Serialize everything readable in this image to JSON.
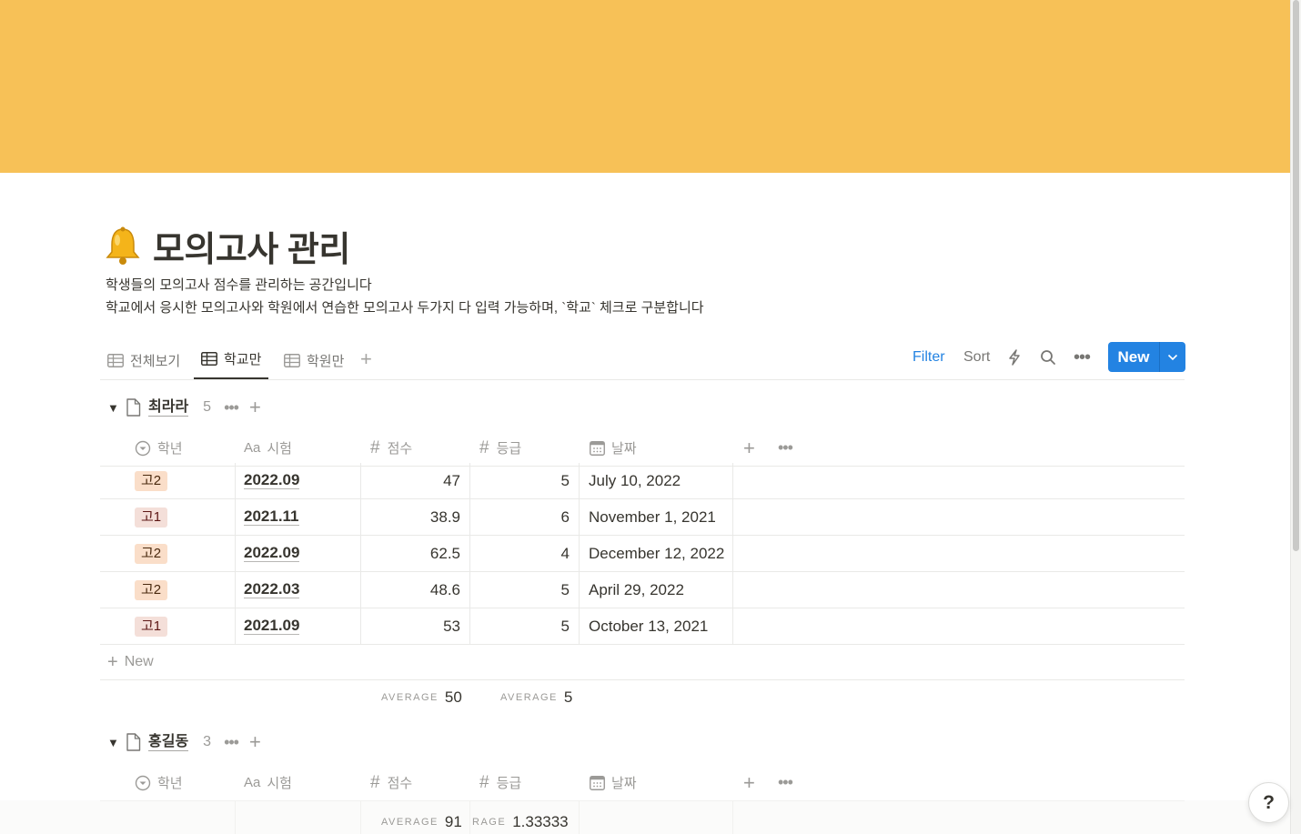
{
  "colors": {
    "cover": "#f7c157",
    "accent": "#2383e2",
    "tag_grade2": "#fadec9",
    "tag_grade1": "#f4dfd9"
  },
  "page": {
    "icon": "bell-emoji",
    "title": "모의고사 관리",
    "description_line1": "학생들의 모의고사 점수를 관리하는 공간입니다",
    "description_line2": "학교에서 응시한 모의고사와 학원에서 연습한 모의고사 두가지 다 입력 가능하며, `학교` 체크로 구분합니다"
  },
  "views": {
    "tabs": [
      {
        "label": "전체보기",
        "icon": "table-icon",
        "active": false
      },
      {
        "label": "학교만",
        "icon": "table-icon",
        "active": true
      },
      {
        "label": "학원만",
        "icon": "table-icon",
        "active": false
      }
    ],
    "add_icon": "plus-icon"
  },
  "toolbar": {
    "filter_label": "Filter",
    "sort_label": "Sort",
    "automation_icon": "lightning-icon",
    "search_icon": "search-icon",
    "more_icon": "ellipsis-icon",
    "new_label": "New"
  },
  "columns": {
    "grade": "학년",
    "exam": "시험",
    "exam_prefix": "Aa",
    "score": "점수",
    "rank": "등급",
    "date": "날짜",
    "number_prefix": "#"
  },
  "groups": [
    {
      "name": "최라라",
      "count": "5",
      "rows": [
        {
          "grade": "고2",
          "exam": "2022.09",
          "score": "47",
          "rank": "5",
          "date": "July 10, 2022"
        },
        {
          "grade": "고1",
          "exam": "2021.11",
          "score": "38.9",
          "rank": "6",
          "date": "November 1, 2021"
        },
        {
          "grade": "고2",
          "exam": "2022.09",
          "score": "62.5",
          "rank": "4",
          "date": "December 12, 2022"
        },
        {
          "grade": "고2",
          "exam": "2022.03",
          "score": "48.6",
          "rank": "5",
          "date": "April 29, 2022"
        },
        {
          "grade": "고1",
          "exam": "2021.09",
          "score": "53",
          "rank": "5",
          "date": "October 13, 2021"
        }
      ],
      "new_row_label": "New",
      "score_calc": {
        "label": "AVERAGE",
        "value": "50"
      },
      "rank_calc": {
        "label": "AVERAGE",
        "value": "5"
      }
    },
    {
      "name": "홍길동",
      "count": "3",
      "score_calc": {
        "label": "AVERAGE",
        "value": "91"
      },
      "rank_calc": {
        "label": "RAGE",
        "value": "1.33333"
      }
    }
  ],
  "help_label": "?"
}
